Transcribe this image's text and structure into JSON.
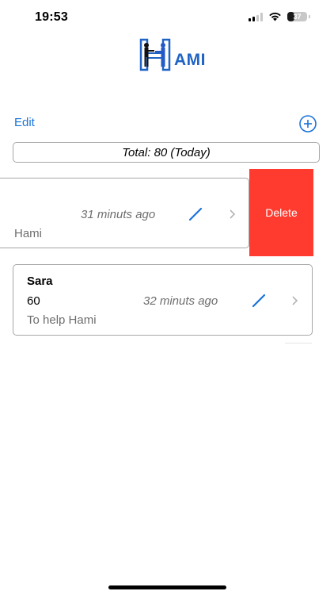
{
  "status_bar": {
    "time": "19:53",
    "battery_percent": "37",
    "icons": [
      "signal-icon",
      "wifi-icon",
      "battery-icon"
    ]
  },
  "header": {
    "logo_text": "AMI",
    "logo_icon": "hami-logo-icon"
  },
  "toolbar": {
    "edit_label": "Edit",
    "add_icon": "plus-circle-icon"
  },
  "summary": {
    "total_text": "Total:  80  (Today)"
  },
  "entries": [
    {
      "name": "",
      "amount": "",
      "time": "31 minuts ago",
      "description": "Hami",
      "swiped": true
    },
    {
      "name": "Sara",
      "amount": "60",
      "time": "32 minuts ago",
      "description": "To help Hami",
      "swiped": false
    }
  ],
  "swipe_actions": {
    "delete_label": "Delete"
  },
  "colors": {
    "accent": "#1a73d9",
    "delete": "#ff3b30",
    "logo_blue": "#1f63c4",
    "border": "#a6a6a6",
    "muted_text": "#6e6e6e"
  }
}
